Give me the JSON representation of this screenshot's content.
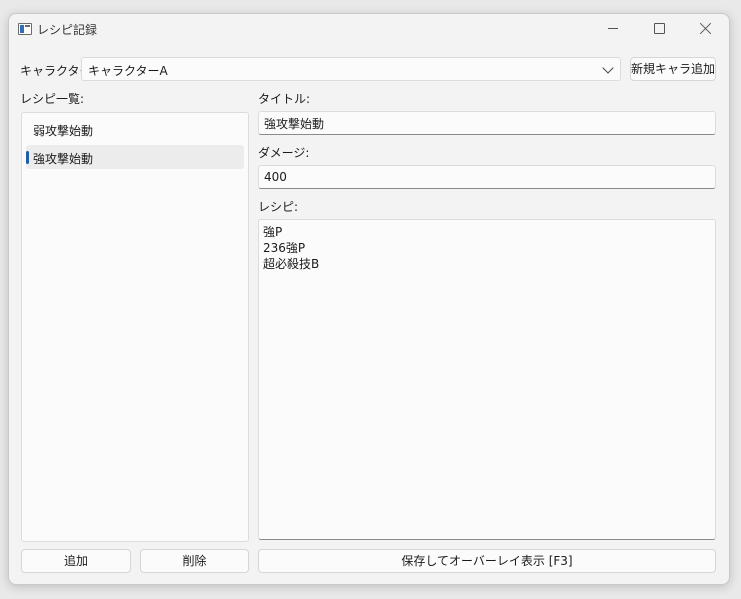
{
  "window": {
    "title": "レシピ記録"
  },
  "character": {
    "label": "キャラクター:",
    "selected": "キャラクターA",
    "add_button": "新規キャラ追加"
  },
  "recipe_list": {
    "label": "レシピ一覧:",
    "items": [
      "弱攻撃始動",
      "強攻撃始動"
    ],
    "selected_index": 1,
    "add_button": "追加",
    "delete_button": "削除"
  },
  "editor": {
    "title_label": "タイトル:",
    "title_value": "強攻撃始動",
    "damage_label": "ダメージ:",
    "damage_value": "400",
    "recipe_label": "レシピ:",
    "recipe_value": "強P\n236強P\n超必殺技B",
    "save_button": "保存してオーバーレイ表示 [F3]"
  },
  "colors": {
    "accent": "#1f5fa8",
    "background": "#f3f3f3"
  }
}
